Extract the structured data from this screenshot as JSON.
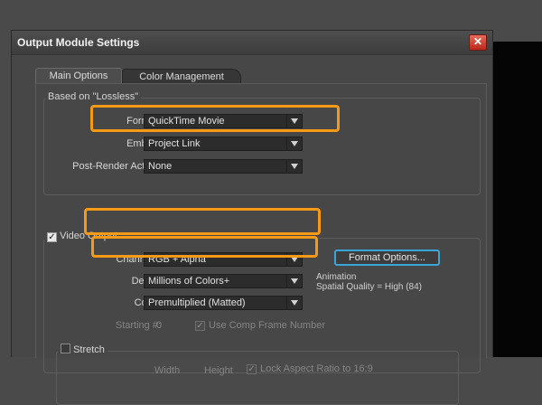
{
  "window": {
    "title": "Output Module Settings"
  },
  "tabs": [
    {
      "label": "Main Options",
      "active": true
    },
    {
      "label": "Color Management",
      "active": false
    }
  ],
  "based_on": {
    "title": "Based on \"Lossless\"",
    "format": {
      "label": "Format:",
      "value": "QuickTime Movie"
    },
    "embed": {
      "label": "Embed:",
      "value": "Project Link"
    },
    "post_render": {
      "label": "Post-Render Action:",
      "value": "None"
    }
  },
  "video_output": {
    "title": "Video Output",
    "checked": true,
    "channels": {
      "label": "Channels:",
      "value": "RGB + Alpha"
    },
    "depth": {
      "label": "Depth:",
      "value": "Millions of Colors+"
    },
    "color": {
      "label": "Color:",
      "value": "Premultiplied (Matted)"
    },
    "format_options_button": "Format Options...",
    "codec_info": [
      "Animation",
      "Spatial Quality = High (84)"
    ],
    "starting": {
      "label": "Starting #:",
      "value": "0"
    },
    "use_comp_frame": {
      "label": "Use Comp Frame Number",
      "checked": true,
      "enabled": false
    },
    "stretch": {
      "label": "Stretch",
      "checked": false,
      "width_label": "Width",
      "height_label": "Height",
      "lock_aspect": {
        "label": "Lock Aspect Ratio to 16:9",
        "checked": true,
        "enabled": false
      }
    }
  },
  "colors": {
    "highlight": "#f59a16",
    "button_focus": "#3aa6d8",
    "close": "#c8392b"
  }
}
